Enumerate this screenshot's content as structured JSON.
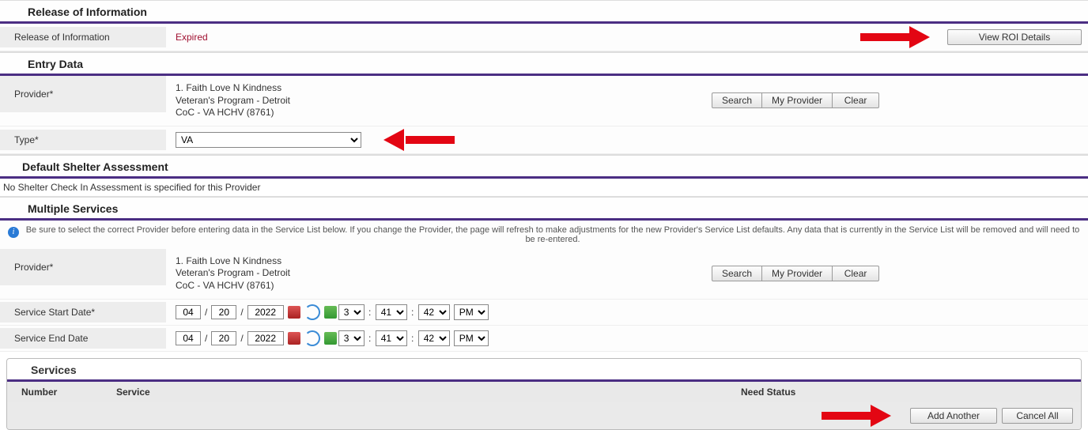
{
  "roi": {
    "title": "Release of Information",
    "row_label": "Release of Information",
    "status": "Expired",
    "view_btn": "View ROI Details"
  },
  "entry": {
    "title": "Entry Data",
    "provider_label": "Provider*",
    "provider_line1": "1. Faith Love N Kindness",
    "provider_line2": "Veteran's Program - Detroit",
    "provider_line3": "CoC - VA HCHV (8761)",
    "search_btn": "Search",
    "my_provider_btn": "My Provider",
    "clear_btn": "Clear",
    "type_label": "Type*",
    "type_value": "VA"
  },
  "shelter": {
    "title": "Default Shelter Assessment",
    "note": "No Shelter Check In Assessment is specified for this Provider"
  },
  "multi": {
    "title": "Multiple Services",
    "info": "Be sure to select the correct Provider before entering data in the Service List below. If you change the Provider, the page will refresh to make adjustments for the new Provider's Service List defaults. Any data that is currently in the Service List will be removed and will need to be re-entered.",
    "provider_label": "Provider*",
    "provider_line1": "1. Faith Love N Kindness",
    "provider_line2": "Veteran's Program - Detroit",
    "provider_line3": "CoC - VA HCHV (8761)",
    "search_btn": "Search",
    "my_provider_btn": "My Provider",
    "clear_btn": "Clear",
    "start_label": "Service Start Date*",
    "end_label": "Service End Date",
    "start": {
      "mm": "04",
      "dd": "20",
      "yyyy": "2022",
      "h": "3",
      "m": "41",
      "s": "42",
      "ampm": "PM"
    },
    "end": {
      "mm": "04",
      "dd": "20",
      "yyyy": "2022",
      "h": "3",
      "m": "41",
      "s": "42",
      "ampm": "PM"
    }
  },
  "services": {
    "title": "Services",
    "col_number": "Number",
    "col_service": "Service",
    "col_need": "Need Status",
    "add_btn": "Add Another",
    "cancel_btn": "Cancel All"
  }
}
